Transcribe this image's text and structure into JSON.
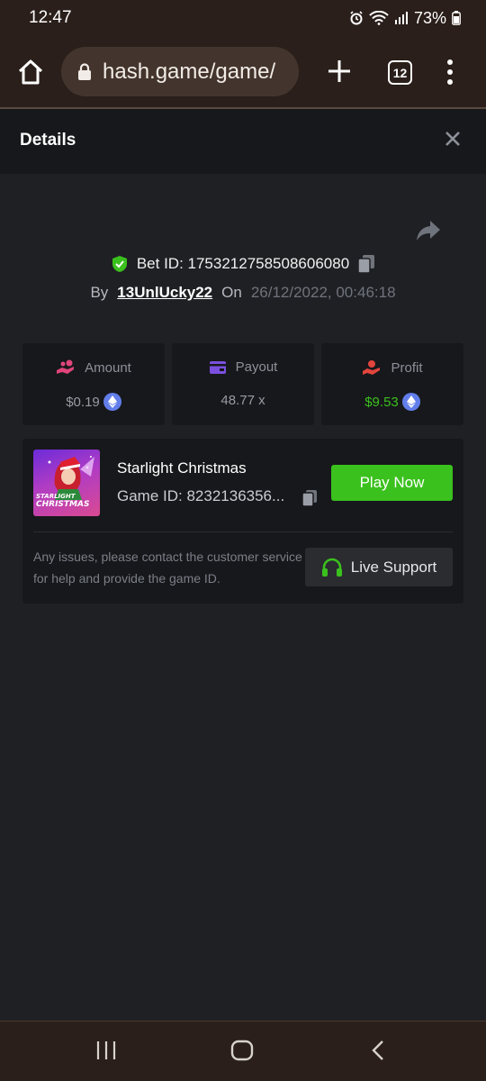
{
  "status": {
    "time": "12:47",
    "battery": "73%"
  },
  "browser": {
    "url": "hash.game/game/",
    "tab_count": "12"
  },
  "details": {
    "title": "Details",
    "bet_id_label": "Bet ID: 1753212758508606080",
    "by_label": "By",
    "username": "13UnlUcky22",
    "on_label": "On",
    "date": "26/12/2022, 00:46:18"
  },
  "stats": [
    {
      "label": "Amount",
      "value": "$0.19",
      "icon": "hand-coins-icon",
      "color": "#e0457b"
    },
    {
      "label": "Payout",
      "value": "48.77 x",
      "icon": "card-icon",
      "color": "#7b4fe0"
    },
    {
      "label": "Profit",
      "value": "$9.53",
      "icon": "hand-profit-icon",
      "color": "#e2453e",
      "value_color": "#3bc11e"
    }
  ],
  "game": {
    "name": "Starlight Christmas",
    "id_label": "Game ID: 8232136356...",
    "thumb_text_1": "STARLIGHT",
    "thumb_text_2": "CHRISTMAS",
    "play_label": "Play Now",
    "issue_text": "Any issues, please contact the customer service for help and provide the game ID.",
    "support_label": "Live Support"
  },
  "colors": {
    "accent_green": "#3bc11e",
    "eth_blue": "#627eea"
  }
}
